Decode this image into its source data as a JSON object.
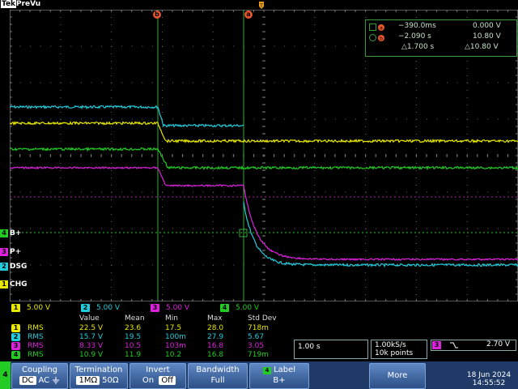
{
  "header": {
    "brand": "Tek",
    "mode": "PreVu"
  },
  "cursors": {
    "b_label": "b",
    "a_label": "a"
  },
  "cursor_readout": {
    "row_a": {
      "time": "−390.0ms",
      "value": "0.000 V"
    },
    "row_b": {
      "time": "−2.090 s",
      "value": "10.80 V"
    },
    "row_delta": {
      "time": "△1.700 s",
      "value": "△10.80 V"
    }
  },
  "channel_labels": [
    {
      "num": "4",
      "text": "B+",
      "color": "#22cc22"
    },
    {
      "num": "3",
      "text": "P+",
      "color": "#dd22dd"
    },
    {
      "num": "2",
      "text": "DSG",
      "color": "#22ccdd"
    },
    {
      "num": "1",
      "text": "CHG",
      "color": "#e8e800"
    }
  ],
  "scales": [
    {
      "num": "1",
      "value": "5.00 V",
      "color": "#e8e800"
    },
    {
      "num": "2",
      "value": "5.00 V",
      "color": "#22ccdd"
    },
    {
      "num": "3",
      "value": "5.00 V",
      "color": "#dd22dd"
    },
    {
      "num": "4",
      "value": "5.00 V",
      "color": "#22cc22"
    }
  ],
  "stats": {
    "headers": [
      "Value",
      "Mean",
      "Min",
      "Max",
      "Std Dev"
    ],
    "rows": [
      {
        "num": "1",
        "type": "RMS",
        "color": "#e8e800",
        "value": "22.5 V",
        "mean": "23.6",
        "min": "17.5",
        "max": "28.0",
        "std": "718m"
      },
      {
        "num": "2",
        "type": "RMS",
        "color": "#22ccdd",
        "value": "15.7 V",
        "mean": "19.5",
        "min": "100m",
        "max": "27.9",
        "std": "5.67"
      },
      {
        "num": "3",
        "type": "RMS",
        "color": "#dd22dd",
        "value": "8.33 V",
        "mean": "10.5",
        "min": "103m",
        "max": "16.8",
        "std": "3.05"
      },
      {
        "num": "4",
        "type": "RMS",
        "color": "#22cc22",
        "value": "10.9 V",
        "mean": "11.9",
        "min": "10.2",
        "max": "16.8",
        "std": "719m"
      }
    ]
  },
  "timebase": "1.00 s",
  "acquisition": {
    "rate": "1.00kS/s",
    "points": "10k points"
  },
  "trigger": {
    "source": "3",
    "level": "2.70 V"
  },
  "bottom": {
    "channel": "4",
    "coupling": {
      "title": "Coupling",
      "opts": [
        "DC",
        "AC"
      ]
    },
    "termination": {
      "title": "Termination",
      "opts": [
        "1MΩ",
        "50Ω"
      ]
    },
    "invert": {
      "title": "Invert",
      "opts": [
        "On",
        "Off"
      ]
    },
    "bandwidth": {
      "title": "Bandwidth",
      "value": "Full"
    },
    "label": {
      "num": "4",
      "title": "Label",
      "value": "B+"
    },
    "more": "More",
    "date": "18 Jun 2024",
    "time": "14:55:52"
  },
  "colors": {
    "ch1": "#e8e800",
    "ch2": "#22ccdd",
    "ch3": "#dd22dd",
    "ch4": "#22cc22",
    "cursor": "#e8572c"
  }
}
